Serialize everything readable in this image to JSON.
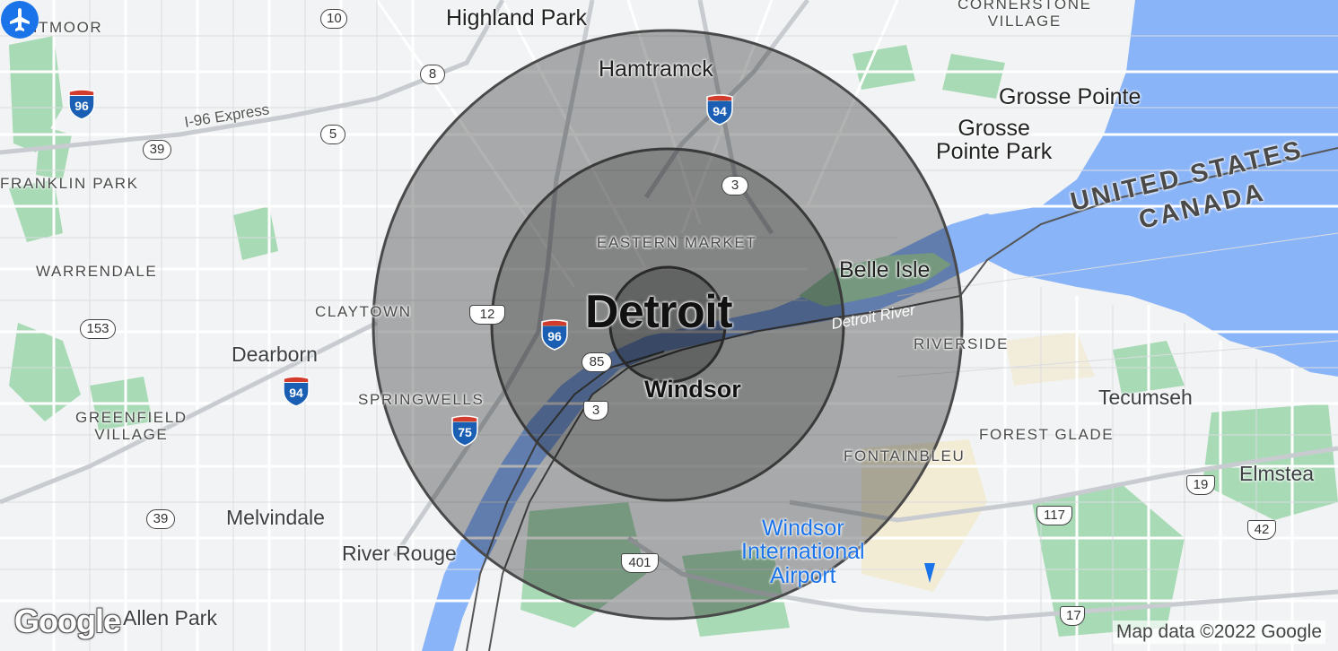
{
  "map": {
    "labels": {
      "detroit": "Detroit",
      "windsor": "Windsor",
      "highland_park": "Highland Park",
      "hamtramck": "Hamtramck",
      "grosse_pointe": "Grosse Pointe",
      "grosse_pointe_park": "Grosse\nPointe Park",
      "belle_isle": "Belle Isle",
      "dearborn": "Dearborn",
      "melvindale": "Melvindale",
      "river_rouge": "River Rouge",
      "allen_park": "Allen Park",
      "tecumseh": "Tecumseh",
      "elmstead": "Elmstea",
      "eastern_market": "EASTERN MARKET",
      "claytown": "CLAYTOWN",
      "springwells": "SPRINGWELLS",
      "riverside": "RIVERSIDE",
      "forest_glade": "FOREST GLADE",
      "fontainbleu": "FONTAINBLEU",
      "franklin_park": "FRANKLIN PARK",
      "warrendale": "WARRENDALE",
      "greenfield_village": "GREENFIELD\nVILLAGE",
      "ightmoor": "IGHTMOOR",
      "cornerstone_village": "CORNERSTONE\nVILLAGE",
      "united_states": "UNITED STATES",
      "canada": "CANADA",
      "detroit_river": "Detroit River",
      "i96_express": "I-96 Express",
      "airport": "Windsor\nInternational\nAirport"
    },
    "routes": {
      "r10": "10",
      "r8": "8",
      "r5": "5",
      "r39a": "39",
      "r39b": "39",
      "r3a": "3",
      "r3b": "3",
      "r153": "153",
      "r12": "12",
      "r85": "85",
      "r401": "401",
      "r117": "117",
      "r19": "19",
      "r42": "42",
      "r17": "17"
    },
    "interstates": {
      "i96a": "96",
      "i96b": "96",
      "i94a": "94",
      "i94b": "94",
      "i75": "75"
    },
    "radius_rings": [
      {
        "name": "inner",
        "fill_opacity": 0.35
      },
      {
        "name": "middle",
        "fill_opacity": 0.35
      },
      {
        "name": "outer",
        "fill_opacity": 0.3
      }
    ],
    "colors": {
      "land": "#f1f3f4",
      "water": "#8ab4f8",
      "park": "#a8dab5",
      "road": "#ffffff",
      "ring": "#303030",
      "interstate_red": "#d33b2c",
      "interstate_blue": "#1a5fb4",
      "airport_blue": "#1a73e8"
    }
  },
  "footer": {
    "logo": "Google",
    "attribution": "Map data ©2022 Google"
  }
}
